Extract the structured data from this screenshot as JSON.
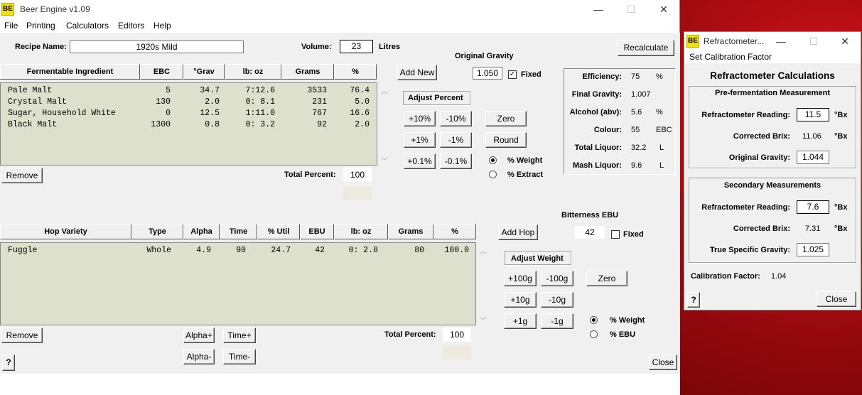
{
  "app": {
    "title": "Beer Engine v1.09",
    "icon_text": "BE",
    "icon_color": "#f3e300"
  },
  "menu": [
    "File",
    "Printing",
    "Calculators",
    "Editors",
    "Help"
  ],
  "window_controls": [
    "—",
    "☐",
    "✕"
  ],
  "recipe": {
    "name_label": "Recipe Name:",
    "name": "1920s Mild",
    "volume_label": "Volume:",
    "volume": "23",
    "volume_unit": "Litres",
    "recalc": "Recalculate"
  },
  "og": {
    "label": "Original Gravity",
    "value": "1.050",
    "fixed_label": "Fixed",
    "fixed_checked": true
  },
  "fermentables": {
    "headers": [
      "Fermentable Ingredient",
      "EBC",
      "°Grav",
      "lb: oz",
      "Grams",
      "%"
    ],
    "rows": [
      [
        "Pale Malt",
        "5",
        "34.7",
        "7:12.6",
        "3533",
        "76.4"
      ],
      [
        "Crystal Malt",
        "130",
        "2.0",
        "0: 8.1",
        "231",
        "5.0"
      ],
      [
        "Sugar, Household White",
        "0",
        "12.5",
        "1:11.0",
        "767",
        "16.6"
      ],
      [
        "Black Malt",
        "1300",
        "0.8",
        "0: 3.2",
        "92",
        "2.0"
      ]
    ],
    "remove": "Remove",
    "add_new": "Add New",
    "total_label": "Total Percent:",
    "total": "100",
    "adjust_label": "Adjust Percent",
    "adjust_buttons": [
      "+10%",
      "-10%",
      "+1%",
      "-1%",
      "+0.1%",
      "-0.1%"
    ],
    "zero": "Zero",
    "round": "Round",
    "radio": [
      {
        "label": "% Weight",
        "on": true
      },
      {
        "label": "% Extract",
        "on": false
      }
    ]
  },
  "stats": [
    {
      "label": "Efficiency:",
      "value": "75",
      "unit": "%"
    },
    {
      "label": "Final Gravity:",
      "value": "1.007",
      "unit": ""
    },
    {
      "label": "Alcohol (abv):",
      "value": "5.6",
      "unit": "%"
    },
    {
      "label": "Colour:",
      "value": "55",
      "unit": "EBC"
    },
    {
      "label": "Total Liquor:",
      "value": "32.2",
      "unit": "L"
    },
    {
      "label": "Mash Liquor:",
      "value": "9.6",
      "unit": "L"
    }
  ],
  "hops": {
    "headers": [
      "Hop Variety",
      "Type",
      "Alpha",
      "Time",
      "% Util",
      "EBU",
      "lb: oz",
      "Grams",
      "%"
    ],
    "rows": [
      [
        "Fuggle",
        "Whole",
        "4.9",
        "90",
        "24.7",
        "42",
        "0: 2.8",
        "80",
        "100.0"
      ]
    ],
    "remove": "Remove",
    "alpha_plus": "Alpha+",
    "alpha_minus": "Alpha-",
    "time_plus": "Time+",
    "time_minus": "Time-",
    "total_label": "Total Percent:",
    "total": "100",
    "add_hop": "Add Hop",
    "bitterness_label": "Bitterness EBU",
    "bitterness": "42",
    "fixed_label": "Fixed",
    "fixed_checked": false,
    "adjust_label": "Adjust Weight",
    "adjust_buttons": [
      "+100g",
      "-100g",
      "+10g",
      "-10g",
      "+1g",
      "-1g"
    ],
    "zero": "Zero",
    "radio": [
      {
        "label": "% Weight",
        "on": true
      },
      {
        "label": "% EBU",
        "on": false
      }
    ]
  },
  "help": "?",
  "close": "Close",
  "refr": {
    "title": "Refractometer...",
    "menu": "Set Calibration Factor",
    "heading": "Refractometer Calculations",
    "pre": {
      "title": "Pre-fermentation Measurement",
      "reading_label": "Refractometer Reading:",
      "reading": "11.5",
      "brix_label": "Corrected Brix:",
      "brix": "11.06",
      "og_label": "Original Gravity:",
      "og": "1.044",
      "unit": "°Bx"
    },
    "sec": {
      "title": "Secondary Measurements",
      "reading_label": "Refractometer Reading:",
      "reading": "7.6",
      "brix_label": "Corrected Brix:",
      "brix": "7.31",
      "sg_label": "True Specific Gravity:",
      "sg": "1.025",
      "unit": "°Bx"
    },
    "cal_label": "Calibration Factor:",
    "cal": "1.04",
    "help": "?",
    "close": "Close"
  }
}
